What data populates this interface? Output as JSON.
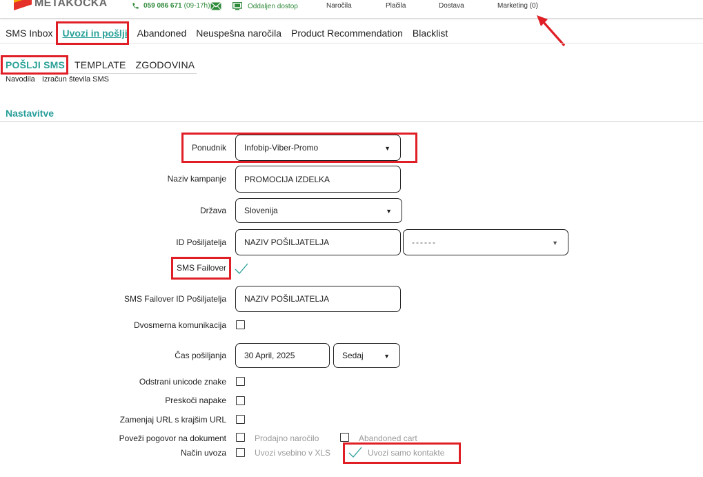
{
  "header": {
    "logo_text": "METAKOCKA",
    "phone": "059 086 671",
    "phone_hours": "(09-17h)",
    "remote_label": "Oddaljen dostop",
    "nav": [
      "Naročila",
      "Plačila",
      "Dostava",
      "Marketing (0)"
    ]
  },
  "tabs": [
    "SMS Inbox",
    "Uvozi in pošlji",
    "Abandoned",
    "Neuspešna naročila",
    "Product Recommendation",
    "Blacklist"
  ],
  "subtabs": [
    "POŠLJI SMS",
    "TEMPLATE",
    "ZGODOVINA"
  ],
  "sublinks": [
    "Navodila",
    "Izračun števila SMS"
  ],
  "section_title": "Nastavitve",
  "form": {
    "provider_label": "Ponudnik",
    "provider_value": "Infobip-Viber-Promo",
    "campaign_label": "Naziv kampanje",
    "campaign_value": "PROMOCIJA IZDELKA",
    "country_label": "Država",
    "country_value": "Slovenija",
    "sender_label": "ID Pošiljatelja",
    "sender_value": "NAZIV POŠILJATELJA",
    "sender_select_value": "------",
    "failover_label": "SMS Failover",
    "failover_sender_label": "SMS Failover ID Pošiljatelja",
    "failover_sender_value": "NAZIV POŠILJATELJA",
    "twoway_label": "Dvosmerna komunikacija",
    "send_time_label": "Čas pošiljanja",
    "send_date_value": "30 April, 2025",
    "send_when_value": "Sedaj",
    "remove_unicode_label": "Odstrani unicode znake",
    "skip_errors_label": "Preskoči napake",
    "shorten_url_label": "Zamenjaj URL s krajšim URL",
    "link_conversation_label": "Poveži pogovor na dokument",
    "sales_order_label": "Prodajno naročilo",
    "abandoned_cart_label": "Abandoned cart",
    "import_mode_label": "Način uvoza",
    "import_xls_label": "Uvozi vsebino v XLS",
    "import_contacts_label": "Uvozi samo kontakte"
  },
  "colors": {
    "accent": "#2aa198",
    "highlight": "#e01e25"
  }
}
